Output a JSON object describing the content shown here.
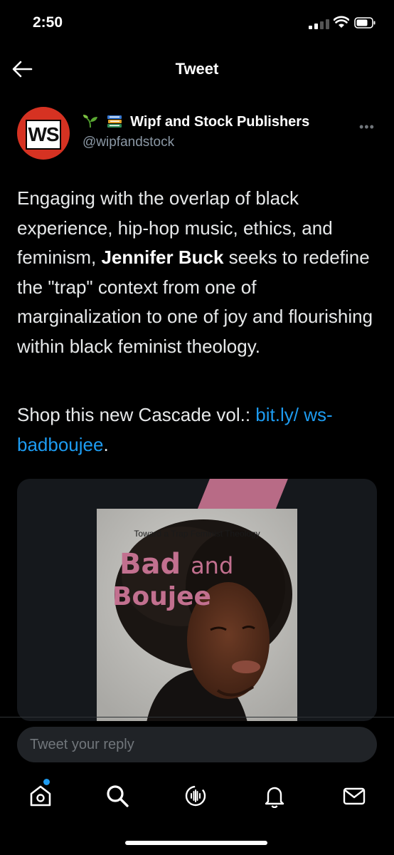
{
  "status_bar": {
    "time": "2:50"
  },
  "header": {
    "title": "Tweet"
  },
  "author": {
    "avatar_text": "WS",
    "name": "Wipf and Stock Publishers",
    "handle": "@wipfandstock"
  },
  "tweet": {
    "text_before": "Engaging with the overlap of black experience, hip-hop music, ethics, and feminism, ",
    "bold_name": "Jennifer Buck",
    "text_after": " seeks to redefine the \"trap\" context from one of marginalization to one of joy and flourishing within black feminist theology.",
    "shop_text": "Shop this new Cascade vol.: ",
    "link_text": "bit.ly/ ws-badboujee",
    "trailing": "."
  },
  "media": {
    "subtitle": "Toward a Trap Feminist Theology",
    "title_bold": "Bad",
    "title_light": "and",
    "title_line2": "Boujee"
  },
  "reply": {
    "placeholder": "Tweet your reply"
  },
  "tabbar": {
    "items": [
      "home-icon",
      "search-icon",
      "spaces-icon",
      "notifications-icon",
      "messages-icon"
    ]
  },
  "colors": {
    "accent": "#1d9bf0",
    "background": "#000000",
    "avatar": "#d63222",
    "cover_title": "#c2708f"
  }
}
